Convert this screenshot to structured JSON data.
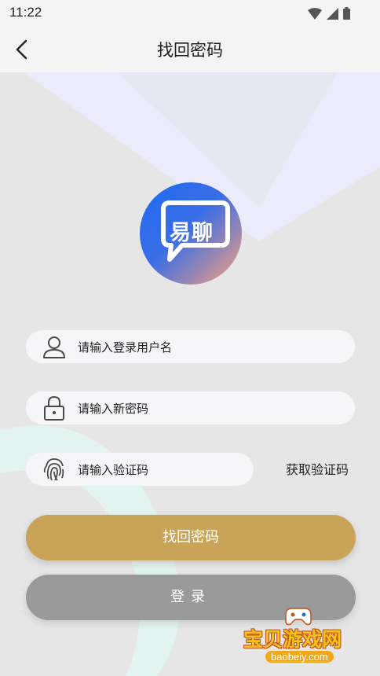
{
  "status_bar": {
    "time": "11:22",
    "icons": [
      "wifi-icon",
      "signal-icon",
      "battery-icon"
    ]
  },
  "app_bar": {
    "title": "找回密码",
    "back_icon": "chevron-left-icon"
  },
  "logo": {
    "text": "易聊"
  },
  "form": {
    "username": {
      "placeholder": "请输入登录用户名",
      "icon": "user-icon"
    },
    "new_password": {
      "placeholder": "请输入新密码",
      "icon": "lock-icon"
    },
    "verification_code": {
      "placeholder": "请输入验证码",
      "icon": "fingerprint-icon"
    },
    "get_code_label": "获取验证码"
  },
  "buttons": {
    "recover_label": "找回密码",
    "login_label": "登录"
  },
  "watermark": {
    "title": "宝贝游戏网",
    "site": "baobeiy.com"
  },
  "colors": {
    "primary_button": "#c9a358",
    "secondary_button": "#9a9a9a",
    "background": "#e6e6e6",
    "field": "#f6f6f9"
  }
}
